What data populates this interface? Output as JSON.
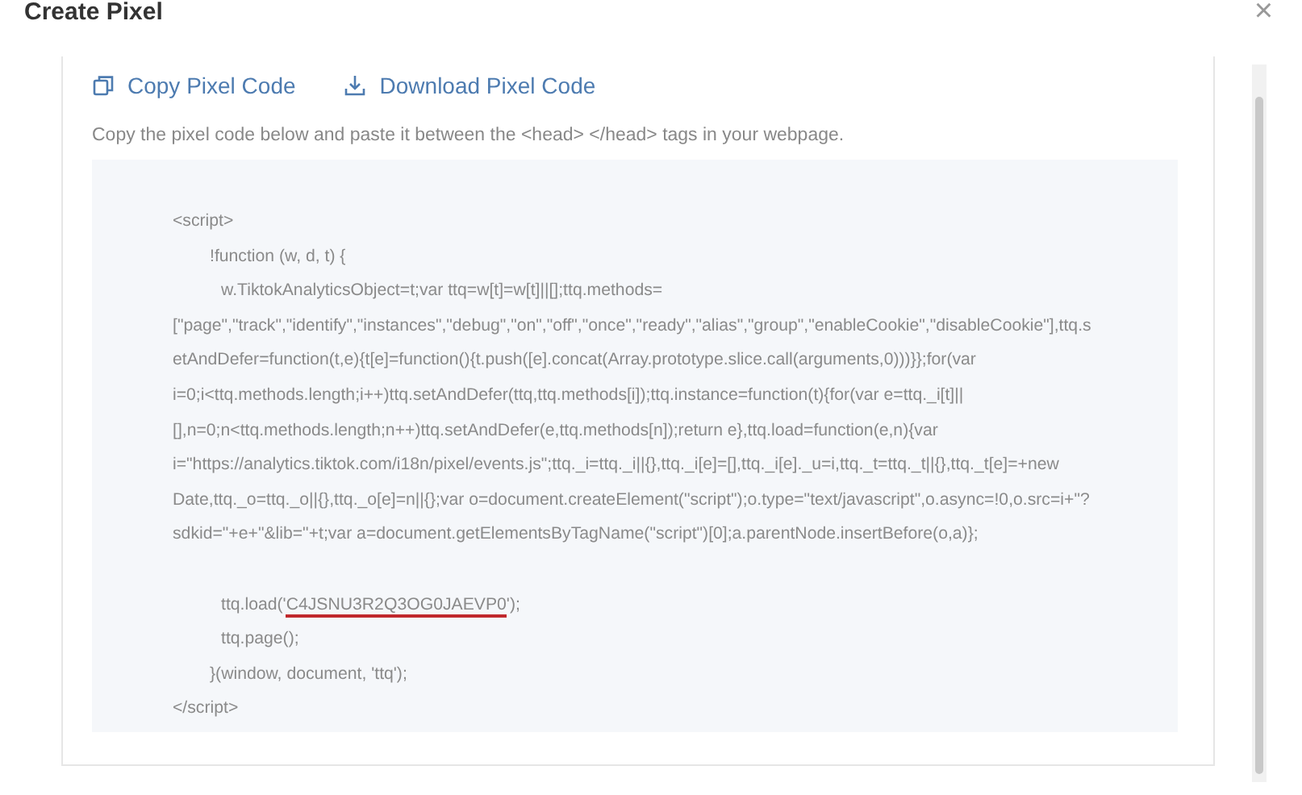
{
  "dialog": {
    "title": "Create Pixel",
    "close": "×"
  },
  "actions": [
    {
      "kind": "copy",
      "label": "Copy Pixel Code"
    },
    {
      "kind": "download",
      "label": "Download Pixel Code"
    }
  ],
  "hint": "Copy the pixel code below and paste it between the <head> </head> tags in your webpage.",
  "code_lines": [
    {
      "kind": "tag",
      "text": "<script>"
    },
    {
      "kind": "fn",
      "text": "!function (w, d, t) {"
    },
    {
      "kind": "body",
      "text": "w.TiktokAnalyticsObject=t;var ttq=w[t]=w[t]||[];ttq.methods="
    },
    {
      "kind": "wrap",
      "text": "[\"page\",\"track\",\"identify\",\"instances\",\"debug\",\"on\",\"off\",\"once\",\"ready\",\"alias\",\"group\",\"enableCookie\",\"disableCookie\"],ttq.s"
    },
    {
      "kind": "wrap",
      "text": "etAndDefer=function(t,e){t[e]=function(){t.push([e].concat(Array.prototype.slice.call(arguments,0)))}};for(var"
    },
    {
      "kind": "wrap",
      "text": "i=0;i<ttq.methods.length;i++)ttq.setAndDefer(ttq,ttq.methods[i]);ttq.instance=function(t){for(var e=ttq._i[t]||"
    },
    {
      "kind": "wrap",
      "text": "[],n=0;n<ttq.methods.length;n++)ttq.setAndDefer(e,ttq.methods[n]);return e},ttq.load=function(e,n){var"
    },
    {
      "kind": "wrap",
      "text": "i=\"https://analytics.tiktok.com/i18n/pixel/events.js\";ttq._i=ttq._i||{},ttq._i[e]=[],ttq._i[e]._u=i,ttq._t=ttq._t||{},ttq._t[e]=+new"
    },
    {
      "kind": "wrap",
      "text": "Date,ttq._o=ttq._o||{},ttq._o[e]=n||{};var o=document.createElement(\"script\");o.type=\"text/javascript\",o.async=!0,o.src=i+\"?"
    },
    {
      "kind": "wrap",
      "text": "sdkid=\"+e+\"&lib=\"+t;var a=document.getElementsByTagName(\"script\")[0];a.parentNode.insertBefore(o,a)};"
    },
    {
      "kind": "blank"
    },
    {
      "kind": "body",
      "text": "ttq.load('",
      "highlight": "C4JSNU3R2Q3OG0JAEVP0",
      "after": "');"
    },
    {
      "kind": "body",
      "text": "ttq.page();"
    },
    {
      "kind": "fn",
      "text": "}(window, document, 'ttq');"
    },
    {
      "kind": "tag",
      "text": "</script>"
    }
  ]
}
